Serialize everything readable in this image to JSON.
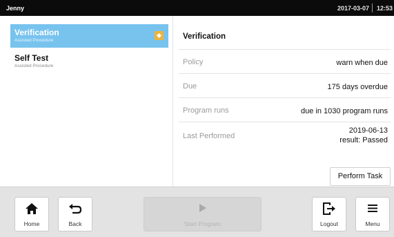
{
  "topbar": {
    "user": "Jenny",
    "date": "2017-03-07",
    "time": "12:53"
  },
  "procedures": [
    {
      "title": "Verification",
      "subtitle": "Assisted Procedure",
      "selected": true,
      "badge_icon": "warning-diamond-icon"
    },
    {
      "title": "Self Test",
      "subtitle": "Assisted Procedure",
      "selected": false
    }
  ],
  "detail": {
    "heading": "Verification",
    "rows": [
      {
        "key": "Policy",
        "value": "warn when due"
      },
      {
        "key": "Due",
        "value": "175 days overdue"
      },
      {
        "key": "Program runs",
        "value": "due in 1030 program runs"
      },
      {
        "key": "Last Performed",
        "value_line1": "2019-06-13",
        "value_line2": "result: Passed"
      }
    ],
    "perform_button": "Perform Task"
  },
  "bottombar": {
    "home": {
      "label": "Home",
      "icon": "home-icon"
    },
    "back": {
      "label": "Back",
      "icon": "back-arrow-icon"
    },
    "start": {
      "label": "Start Program",
      "icon": "play-icon",
      "enabled": false
    },
    "logout": {
      "label": "Logout",
      "icon": "logout-icon"
    },
    "menu": {
      "label": "Menu",
      "icon": "hamburger-menu-icon"
    }
  },
  "colors": {
    "selected_bg": "#78c3ee",
    "badge": "#f0b23a",
    "topbar_bg": "#0b0b0b",
    "bottombar_bg": "#e3e3e3"
  }
}
